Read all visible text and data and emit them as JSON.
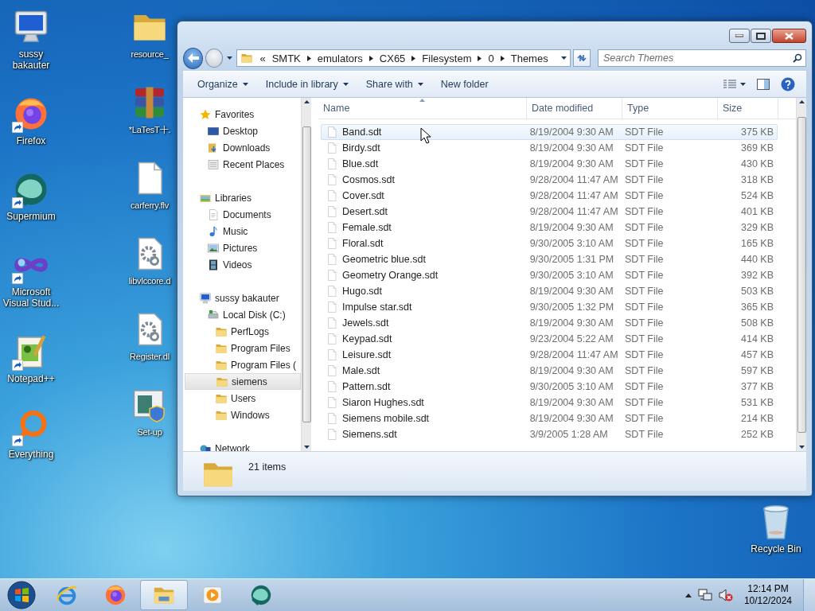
{
  "desktop": {
    "left_icons": [
      {
        "label": "sussy bakauter",
        "kind": "computer",
        "shortcut": false
      },
      {
        "label": "Firefox",
        "kind": "firefox",
        "shortcut": true
      },
      {
        "label": "Supermium",
        "kind": "supermium",
        "shortcut": true
      },
      {
        "label": "Microsoft Visual Stud...",
        "kind": "vs",
        "shortcut": true
      },
      {
        "label": "Notepad++",
        "kind": "notepad",
        "shortcut": true
      },
      {
        "label": "Everything",
        "kind": "everything",
        "shortcut": true
      }
    ],
    "right_icons": [
      {
        "label": "resource_",
        "kind": "folder",
        "shortcut": false
      },
      {
        "label": "*LaTesT十.",
        "kind": "archive",
        "shortcut": false
      },
      {
        "label": "carferry.flv",
        "kind": "file",
        "shortcut": false
      },
      {
        "label": "libvlccore.d",
        "kind": "dll",
        "shortcut": false
      },
      {
        "label": "Register.dl",
        "kind": "dll",
        "shortcut": false
      },
      {
        "label": "Set-up",
        "kind": "setup",
        "shortcut": false
      }
    ],
    "recycle_bin": {
      "label": "Recycle Bin",
      "kind": "recycle",
      "shortcut": false
    }
  },
  "explorer": {
    "address": {
      "overflow": "«",
      "path": [
        "SMTK",
        "emulators",
        "CX65",
        "Filesystem",
        "0",
        "Themes"
      ]
    },
    "search": {
      "placeholder": "Search Themes"
    },
    "toolbar": [
      {
        "label": "Organize",
        "dropdown": true
      },
      {
        "label": "Include in library",
        "dropdown": true
      },
      {
        "label": "Share with",
        "dropdown": true
      },
      {
        "label": "New folder",
        "dropdown": false
      }
    ],
    "navigation": [
      {
        "label": "Favorites",
        "kind": "star",
        "selected": false,
        "children": [
          {
            "label": "Desktop",
            "kind": "desktop",
            "selected": false
          },
          {
            "label": "Downloads",
            "kind": "downloads",
            "selected": false
          },
          {
            "label": "Recent Places",
            "kind": "recent",
            "selected": false
          }
        ]
      },
      {
        "label": "Libraries",
        "kind": "library",
        "selected": false,
        "children": [
          {
            "label": "Documents",
            "kind": "documents",
            "selected": false
          },
          {
            "label": "Music",
            "kind": "music",
            "selected": false
          },
          {
            "label": "Pictures",
            "kind": "pictures",
            "selected": false
          },
          {
            "label": "Videos",
            "kind": "videos",
            "selected": false
          }
        ]
      },
      {
        "label": "sussy bakauter",
        "kind": "computer",
        "selected": false,
        "children": [
          {
            "label": "Local Disk (C:)",
            "kind": "disk",
            "selected": false,
            "children": [
              {
                "label": "PerfLogs",
                "kind": "folder",
                "selected": false
              },
              {
                "label": "Program Files",
                "kind": "folder",
                "selected": false
              },
              {
                "label": "Program Files (",
                "kind": "folder",
                "selected": false
              },
              {
                "label": "siemens",
                "kind": "folder",
                "selected": true
              },
              {
                "label": "Users",
                "kind": "folder",
                "selected": false
              },
              {
                "label": "Windows",
                "kind": "folder",
                "selected": false
              }
            ]
          }
        ]
      },
      {
        "label": "Network",
        "kind": "network",
        "selected": false
      }
    ],
    "columns": [
      {
        "label": "Name",
        "sorted": true
      },
      {
        "label": "Date modified",
        "sorted": false
      },
      {
        "label": "Type",
        "sorted": false
      },
      {
        "label": "Size",
        "sorted": false
      }
    ],
    "files": [
      {
        "name": "Band.sdt",
        "modified": "8/19/2004 9:30 AM",
        "type": "SDT File",
        "size": "375 KB",
        "hovered": true
      },
      {
        "name": "Birdy.sdt",
        "modified": "8/19/2004 9:30 AM",
        "type": "SDT File",
        "size": "369 KB",
        "hovered": false
      },
      {
        "name": "Blue.sdt",
        "modified": "8/19/2004 9:30 AM",
        "type": "SDT File",
        "size": "430 KB",
        "hovered": false
      },
      {
        "name": "Cosmos.sdt",
        "modified": "9/28/2004 11:47 AM",
        "type": "SDT File",
        "size": "318 KB",
        "hovered": false
      },
      {
        "name": "Cover.sdt",
        "modified": "9/28/2004 11:47 AM",
        "type": "SDT File",
        "size": "524 KB",
        "hovered": false
      },
      {
        "name": "Desert.sdt",
        "modified": "9/28/2004 11:47 AM",
        "type": "SDT File",
        "size": "401 KB",
        "hovered": false
      },
      {
        "name": "Female.sdt",
        "modified": "8/19/2004 9:30 AM",
        "type": "SDT File",
        "size": "329 KB",
        "hovered": false
      },
      {
        "name": "Floral.sdt",
        "modified": "9/30/2005 3:10 AM",
        "type": "SDT File",
        "size": "165 KB",
        "hovered": false
      },
      {
        "name": "Geometric blue.sdt",
        "modified": "9/30/2005 1:31 PM",
        "type": "SDT File",
        "size": "440 KB",
        "hovered": false
      },
      {
        "name": "Geometry Orange.sdt",
        "modified": "9/30/2005 3:10 AM",
        "type": "SDT File",
        "size": "392 KB",
        "hovered": false
      },
      {
        "name": "Hugo.sdt",
        "modified": "8/19/2004 9:30 AM",
        "type": "SDT File",
        "size": "503 KB",
        "hovered": false
      },
      {
        "name": "Impulse star.sdt",
        "modified": "9/30/2005 1:32 PM",
        "type": "SDT File",
        "size": "365 KB",
        "hovered": false
      },
      {
        "name": "Jewels.sdt",
        "modified": "8/19/2004 9:30 AM",
        "type": "SDT File",
        "size": "508 KB",
        "hovered": false
      },
      {
        "name": "Keypad.sdt",
        "modified": "9/23/2004 5:22 AM",
        "type": "SDT File",
        "size": "414 KB",
        "hovered": false
      },
      {
        "name": "Leisure.sdt",
        "modified": "9/28/2004 11:47 AM",
        "type": "SDT File",
        "size": "457 KB",
        "hovered": false
      },
      {
        "name": "Male.sdt",
        "modified": "8/19/2004 9:30 AM",
        "type": "SDT File",
        "size": "597 KB",
        "hovered": false
      },
      {
        "name": "Pattern.sdt",
        "modified": "9/30/2005 3:10 AM",
        "type": "SDT File",
        "size": "377 KB",
        "hovered": false
      },
      {
        "name": "Siaron Hughes.sdt",
        "modified": "8/19/2004 9:30 AM",
        "type": "SDT File",
        "size": "531 KB",
        "hovered": false
      },
      {
        "name": "Siemens mobile.sdt",
        "modified": "8/19/2004 9:30 AM",
        "type": "SDT File",
        "size": "214 KB",
        "hovered": false
      },
      {
        "name": "Siemens.sdt",
        "modified": "3/9/2005 1:28 AM",
        "type": "SDT File",
        "size": "252 KB",
        "hovered": false
      }
    ],
    "status": "21 items"
  },
  "taskbar": {
    "apps": [
      {
        "kind": "ie",
        "active": false
      },
      {
        "kind": "firefox",
        "active": false
      },
      {
        "kind": "explorer",
        "active": true
      },
      {
        "kind": "media",
        "active": false
      },
      {
        "kind": "supermium",
        "active": false
      }
    ],
    "tray": {
      "volume_muted": true,
      "time": "12:14 PM",
      "date": "10/12/2024"
    }
  }
}
